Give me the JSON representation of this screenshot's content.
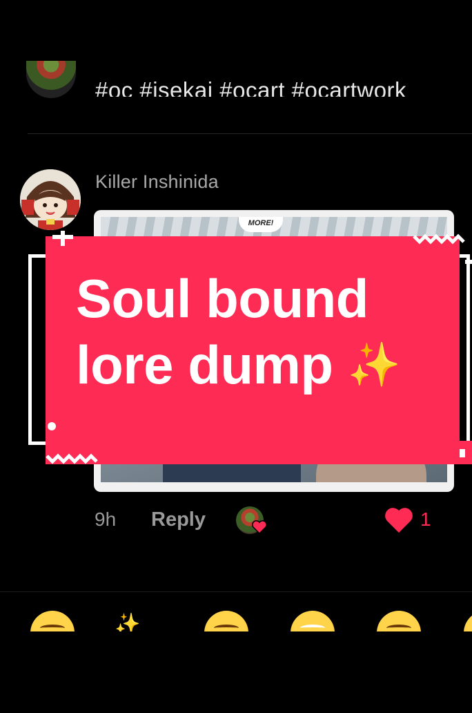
{
  "previous_comment": {
    "text": "#oc #isekai #ocart #ocartwork"
  },
  "comment": {
    "username": "Killer Inshinida",
    "image_caption": "MORE!",
    "time": "9h",
    "reply_label": "Reply",
    "like_count": "1"
  },
  "sticker": {
    "line1": "Soul bound",
    "line2": "lore dump",
    "sparkle": "✨"
  },
  "emoji_bar": {
    "sparkle": "✨"
  },
  "colors": {
    "accent": "#fe2c55",
    "background": "#000000",
    "sparkle": "#ffd21e"
  }
}
